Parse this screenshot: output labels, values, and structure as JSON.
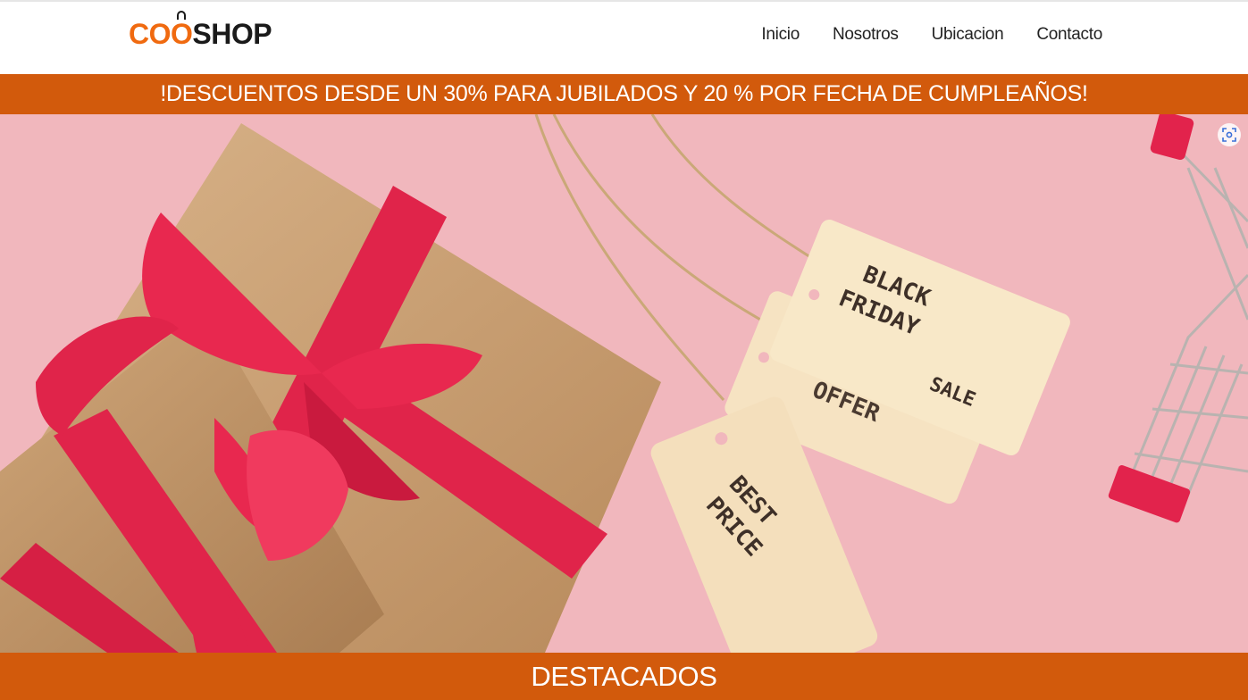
{
  "brand": {
    "logo_part1": "CO",
    "logo_part2": "O",
    "logo_part3": "SHOP",
    "accent_color": "#f06a10",
    "banner_color": "#d25a0c"
  },
  "nav": {
    "items": [
      {
        "label": "Inicio"
      },
      {
        "label": "Nosotros"
      },
      {
        "label": "Ubicacion"
      },
      {
        "label": "Contacto"
      }
    ]
  },
  "promo": {
    "text": "!DESCUENTOS DESDE UN 30% PARA JUBILADOS Y 20 % POR FECHA DE CUMPLEAÑOS!"
  },
  "hero": {
    "tags": {
      "tag1_line1": "BLACK",
      "tag1_line2": "FRIDAY",
      "tag1_line3": "SALE",
      "tag2_text": "OFFER",
      "tag3_line1": "BEST",
      "tag3_line2": "PRICE"
    },
    "icon": "visual-search-icon"
  },
  "section": {
    "title": "DESTACADOS"
  }
}
